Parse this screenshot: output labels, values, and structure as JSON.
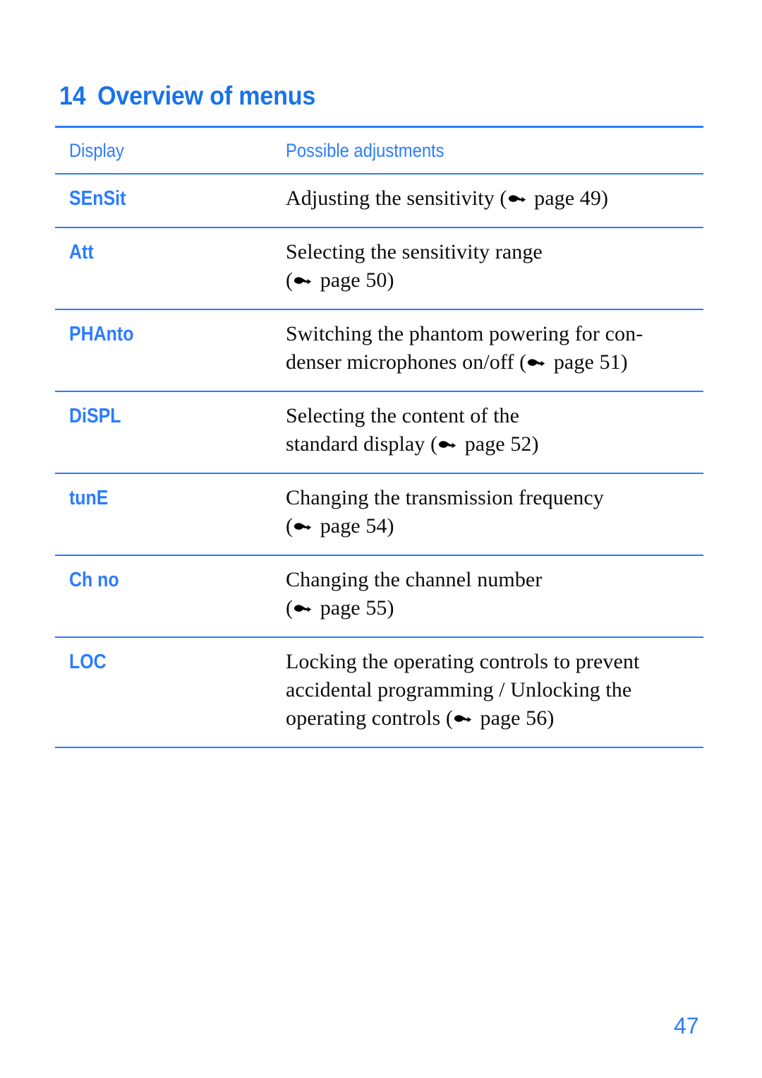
{
  "heading": {
    "number": "14",
    "title": "Overview of menus"
  },
  "table": {
    "columns": {
      "display": "Display",
      "adjustments": "Possible adjustments"
    },
    "rows": [
      {
        "display": "SEnSit",
        "lines": [
          [
            {
              "t": "Adjusting the sensitivity ("
            },
            {
              "icon": "pointing-hand-icon"
            },
            {
              "t": " page 49)"
            }
          ]
        ]
      },
      {
        "display": "Att",
        "lines": [
          [
            {
              "t": "Selecting the sensitivity range"
            }
          ],
          [
            {
              "t": "("
            },
            {
              "icon": "pointing-hand-icon"
            },
            {
              "t": " page 50)"
            }
          ]
        ]
      },
      {
        "display": "PHAnto",
        "lines": [
          [
            {
              "t": "Switching the phantom powering for con-"
            }
          ],
          [
            {
              "t": "denser microphones on/off ("
            },
            {
              "icon": "pointing-hand-icon"
            },
            {
              "t": " page 51)"
            }
          ]
        ]
      },
      {
        "display": "DiSPL",
        "lines": [
          [
            {
              "t": "Selecting the content of the"
            }
          ],
          [
            {
              "t": "standard display ("
            },
            {
              "icon": "pointing-hand-icon"
            },
            {
              "t": " page 52)"
            }
          ]
        ]
      },
      {
        "display": "tunE",
        "lines": [
          [
            {
              "t": "Changing the transmission frequency"
            }
          ],
          [
            {
              "t": "("
            },
            {
              "icon": "pointing-hand-icon"
            },
            {
              "t": " page 54)"
            }
          ]
        ]
      },
      {
        "display": "Ch no",
        "lines": [
          [
            {
              "t": "Changing the channel number"
            }
          ],
          [
            {
              "t": "("
            },
            {
              "icon": "pointing-hand-icon"
            },
            {
              "t": " page 55)"
            }
          ]
        ]
      },
      {
        "display": "LOC",
        "lines": [
          [
            {
              "t": "Locking the operating controls to prevent"
            }
          ],
          [
            {
              "t": "accidental programming / Unlocking the"
            }
          ],
          [
            {
              "t": "operating controls ("
            },
            {
              "icon": "pointing-hand-icon"
            },
            {
              "t": " page 56)"
            }
          ]
        ]
      }
    ]
  },
  "folio": "47",
  "colors": {
    "accent_blue": "#2b7cff",
    "heading_blue": "#1a73e8",
    "body_black": "#0c0c0c"
  }
}
